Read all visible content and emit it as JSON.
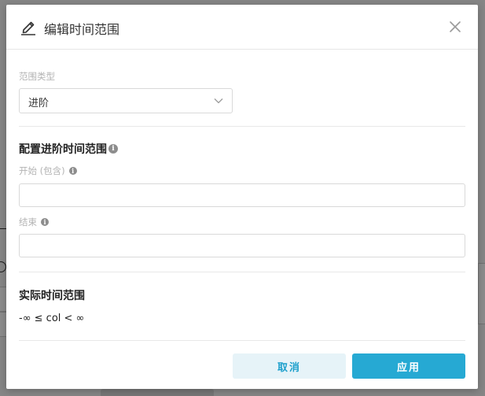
{
  "modal": {
    "title": "编辑时间范围",
    "close_icon": "close-icon",
    "edit_icon": "pencil-icon"
  },
  "range_type": {
    "label": "范围类型",
    "selected": "进阶",
    "chevron_icon": "chevron-down-icon"
  },
  "advanced": {
    "section_title": "配置进阶时间范围",
    "start_label": "开始 (包含)",
    "start_value": "",
    "end_label": "结束",
    "end_value": "",
    "info_icon": "info-icon"
  },
  "actual": {
    "section_title": "实际时间范围",
    "value": "-∞ ≤ col < ∞"
  },
  "footer": {
    "cancel_label": "取消",
    "apply_label": "应用"
  },
  "colors": {
    "primary": "#26a9d3",
    "cancel_bg": "#e6f3f8",
    "cancel_text": "#1c9fcc"
  }
}
